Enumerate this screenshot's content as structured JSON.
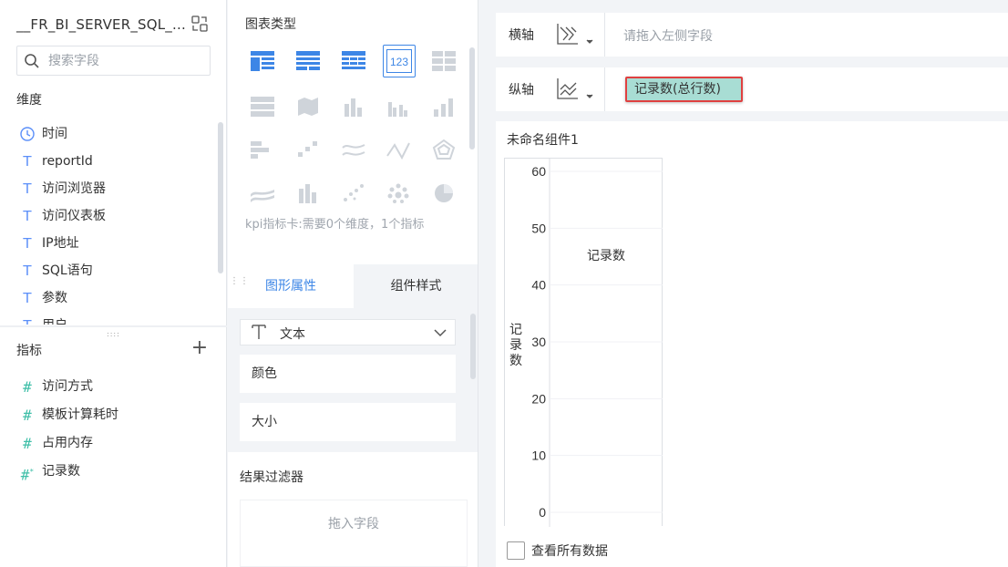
{
  "left_panel": {
    "datasource_title": "__FR_BI_SERVER_SQL_...",
    "search_placeholder": "搜索字段",
    "dimension_label": "维度",
    "dimensions": [
      {
        "icon": "clock-icon",
        "label": "时间"
      },
      {
        "icon": "text-type-icon",
        "label": "reportId"
      },
      {
        "icon": "text-type-icon",
        "label": "访问浏览器"
      },
      {
        "icon": "text-type-icon",
        "label": "访问仪表板"
      },
      {
        "icon": "text-type-icon",
        "label": "IP地址"
      },
      {
        "icon": "text-type-icon",
        "label": "SQL语句"
      },
      {
        "icon": "text-type-icon",
        "label": "参数"
      },
      {
        "icon": "text-type-icon",
        "label": "用户"
      }
    ],
    "measure_label": "指标",
    "measures": [
      {
        "icon": "number-type-icon",
        "label": "访问方式"
      },
      {
        "icon": "number-type-icon",
        "label": "模板计算耗时"
      },
      {
        "icon": "number-type-icon",
        "label": "占用内存"
      },
      {
        "icon": "record-count-icon",
        "label": "记录数"
      }
    ]
  },
  "middle_panel": {
    "chart_type_title": "图表类型",
    "kpi_tip": "kpi指标卡:需要0个维度，1个指标",
    "tabs": [
      {
        "label": "图形属性",
        "active": true
      },
      {
        "label": "组件样式",
        "active": false
      }
    ],
    "text_select_label": "文本",
    "color_label": "颜色",
    "size_label": "大小",
    "filter_title": "结果过滤器",
    "drop_hint": "拖入字段"
  },
  "right_panel": {
    "x_axis_label": "横轴",
    "x_axis_hint": "请拖入左侧字段",
    "y_axis_label": "纵轴",
    "y_axis_field": "记录数(总行数)",
    "component_title": "未命名组件1",
    "show_all_label": "查看所有数据"
  },
  "chart_data": {
    "type": "bar",
    "categories": [
      "记录数"
    ],
    "series": [
      {
        "values": [
          0
        ]
      }
    ],
    "ylabel": "记录数",
    "ylim": [
      0,
      60
    ],
    "yticks": [
      0,
      10,
      20,
      30,
      40,
      50,
      60
    ],
    "annotations": [
      "记录数"
    ]
  },
  "colors": {
    "accent": "#3d86e6",
    "pill_bg": "#a8ddd4",
    "pill_border": "#e04040",
    "measure_icon": "#3fbfa8"
  }
}
